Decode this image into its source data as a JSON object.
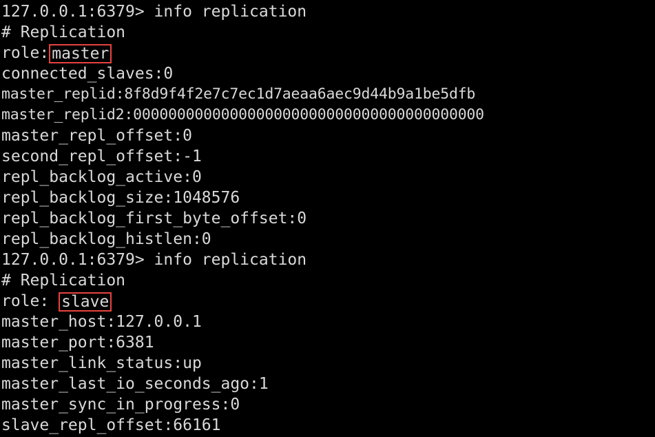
{
  "terminal": {
    "background_color": "#000000",
    "text_color": "#d9d9d9",
    "highlight_color": "#e8433f",
    "lines": [
      {
        "id": "prompt-1",
        "text": "127.0.0.1:6379> info replication"
      },
      {
        "id": "section-header-1",
        "text": "# Replication"
      },
      {
        "id": "role-master",
        "prefix": "role:",
        "highlighted": "master",
        "suffix": ""
      },
      {
        "id": "connected-slaves",
        "text": "connected_slaves:0"
      },
      {
        "id": "master-replid",
        "text": "master_replid:8f8d9f4f2e7c7ec1d7aeaa6aec9d44b9a1be5dfb"
      },
      {
        "id": "master-replid2",
        "text": "master_replid2:0000000000000000000000000000000000000000"
      },
      {
        "id": "master-repl-offset",
        "text": "master_repl_offset:0"
      },
      {
        "id": "second-repl-offset",
        "text": "second_repl_offset:-1"
      },
      {
        "id": "repl-backlog-active",
        "text": "repl_backlog_active:0"
      },
      {
        "id": "repl-backlog-size",
        "text": "repl_backlog_size:1048576"
      },
      {
        "id": "repl-backlog-first-byte-offset",
        "text": "repl_backlog_first_byte_offset:0"
      },
      {
        "id": "repl-backlog-histlen",
        "text": "repl_backlog_histlen:0"
      },
      {
        "id": "prompt-2",
        "text": "127.0.0.1:6379> info replication"
      },
      {
        "id": "section-header-2",
        "text": "# Replication"
      },
      {
        "id": "role-slave",
        "prefix": "role: ",
        "highlighted": "slave",
        "suffix": ""
      },
      {
        "id": "master-host",
        "text": "master_host:127.0.0.1"
      },
      {
        "id": "master-port",
        "text": "master_port:6381"
      },
      {
        "id": "master-link-status",
        "text": "master_link_status:up"
      },
      {
        "id": "master-last-io-seconds-ago",
        "text": "master_last_io_seconds_ago:1"
      },
      {
        "id": "master-sync-in-progress",
        "text": "master_sync_in_progress:0"
      },
      {
        "id": "slave-repl-offset",
        "text": "slave_repl_offset:66161"
      }
    ]
  }
}
